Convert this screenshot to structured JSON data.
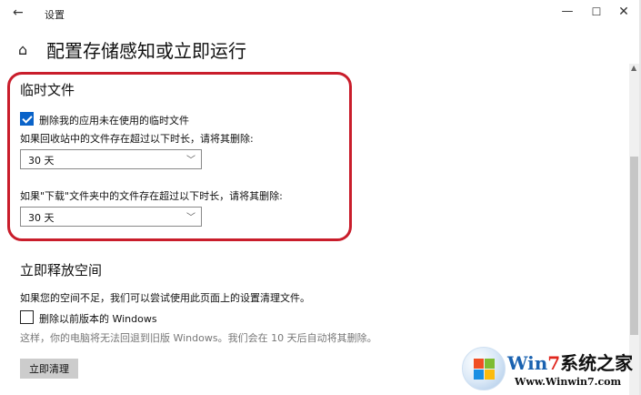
{
  "window": {
    "app_title": "设置",
    "back_icon": "←",
    "minimize_icon": "—",
    "maximize_icon": "☐",
    "close_icon": "✕"
  },
  "page": {
    "home_icon": "⌂",
    "title": "配置存储感知或立即运行"
  },
  "temp_files": {
    "title": "临时文件",
    "delete_checkbox_label": "删除我的应用未在使用的临时文件",
    "delete_checked": true,
    "recycle_label": "如果回收站中的文件存在超过以下时长，请将其删除:",
    "recycle_value": "30 天",
    "downloads_label": "如果\"下载\"文件夹中的文件存在超过以下时长，请将其删除:",
    "downloads_value": "30 天",
    "chevron_icon": "﹀",
    "highlight_color": "#c91d2b"
  },
  "free_space": {
    "title": "立即释放空间",
    "description": "如果您的空间不足，我们可以尝试使用此页面上的设置清理文件。",
    "prev_windows_label": "删除以前版本的 Windows",
    "prev_windows_checked": false,
    "note": "这样，你的电脑将无法回退到旧版 Windows。我们会在 10 天后自动将其删除。",
    "clean_button": "立即清理"
  },
  "scrollbar": {
    "up_icon": "▲"
  },
  "watermark": {
    "title_w": "Win",
    "title_7": "7",
    "title_cn": "系统之家",
    "url": "Www.Winwin7.com"
  },
  "colors": {
    "accent": "#0a63c9",
    "highlight": "#c91d2b"
  }
}
